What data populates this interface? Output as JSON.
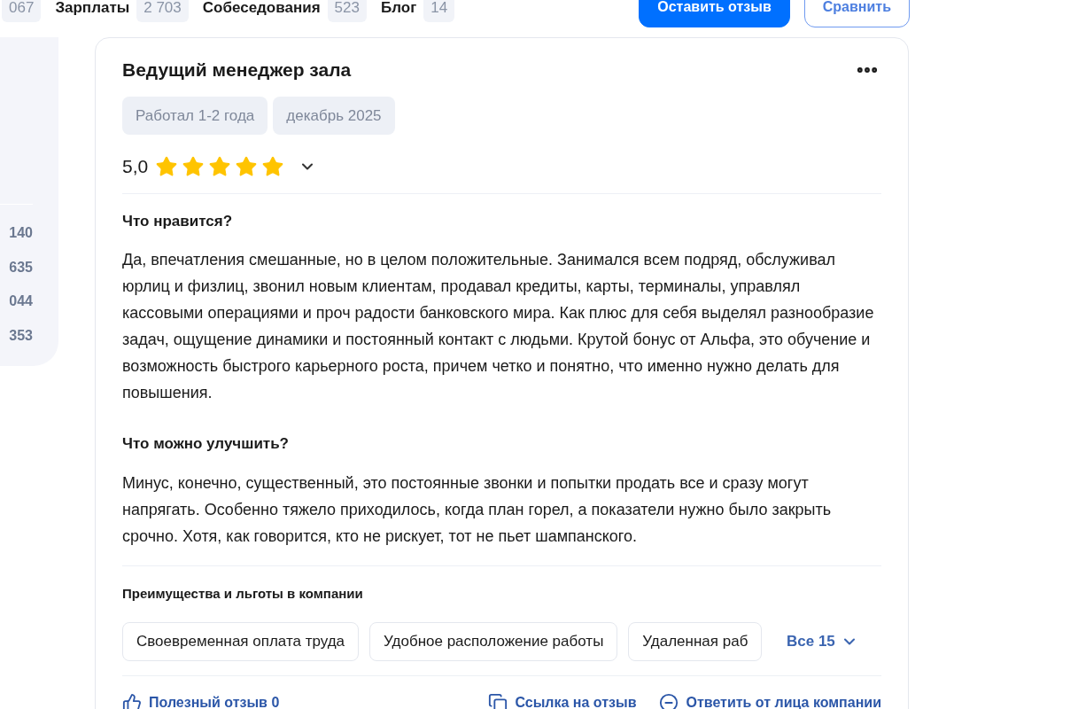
{
  "nav": [
    {
      "count": "067"
    },
    {
      "label": "Зарплаты",
      "count": "2 703"
    },
    {
      "label": "Собеседования",
      "count": "523"
    },
    {
      "label": "Блог",
      "count": "14"
    }
  ],
  "header_buttons": [
    {
      "kind": "primary",
      "label": "Оставить отзыв"
    },
    {
      "kind": "secondary",
      "label": "Сравнить"
    }
  ],
  "sidebar": {
    "values": [
      "140",
      "635",
      "044",
      "353"
    ]
  },
  "review": {
    "title": "Ведущий менеджер зала",
    "tags": [
      "Работал 1-2 года",
      "декабрь 2025"
    ],
    "rating": "5,0",
    "stars": 5,
    "sections": [
      {
        "heading": "Что нравится?",
        "text": "Да, впечатления смешанные, но в целом положительные. Занимался всем подряд, обслуживал юрлиц и физлиц, звонил новым клиентам, продавал кредиты, карты, терминалы, управлял кассовыми операциями и проч радости банковского мира. Как плюс для себя выделял разнообразие задач, ощущение динамики и постоянный контакт с людьми. Крутой бонус от Альфа, это обучение и возможность быстрого карьерного роста, причем четко и понятно, что именно нужно делать для повышения."
      },
      {
        "heading": "Что можно улучшить?",
        "text": "Минус, конечно, существенный, это постоянные звонки и попытки продать все и сразу могут напрягать. Особенно тяжело приходилось, когда план горел, а показатели нужно было закрыть срочно. Хотя, как говорится, кто не рискует, тот не пьет шампанского."
      }
    ],
    "benefits": {
      "heading": "Преимущества и льготы в компании",
      "items": [
        "Своевременная оплата труда",
        "Удобное расположение работы",
        "Удаленная раб"
      ],
      "more": "Все 15"
    },
    "actions": [
      {
        "kind": "like",
        "label": "Полезный отзыв 0"
      },
      {
        "kind": "link",
        "label": "Ссылка на отзыв"
      },
      {
        "kind": "reply",
        "label": "Ответить от лица компании"
      }
    ]
  }
}
